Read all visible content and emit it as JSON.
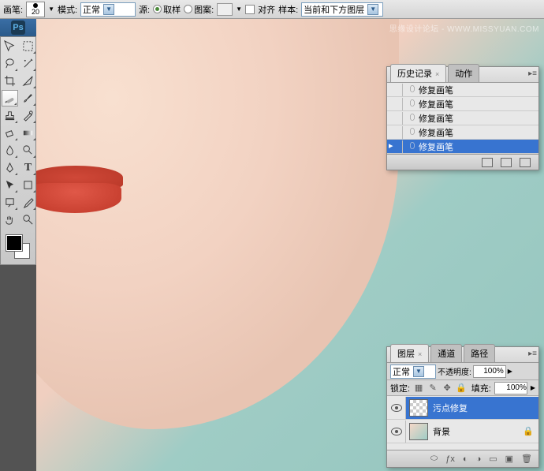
{
  "watermark": "思缘设计论坛 - WWW.MISSYUAN.COM",
  "toolbar": {
    "brush_lbl": "画笔:",
    "brush_size": "20",
    "mode_lbl": "模式:",
    "mode_val": "正常",
    "source_lbl": "源:",
    "sample_lbl": "取样",
    "pattern_lbl": "图案:",
    "align_lbl": "对齐",
    "sample_type_lbl": "样本:",
    "sample_type_val": "当前和下方图层"
  },
  "ps": "Ps",
  "history_panel": {
    "tabs": [
      {
        "label": "历史记录",
        "active": true
      },
      {
        "label": "动作",
        "active": false
      }
    ],
    "items": [
      {
        "label": "修复画笔",
        "sel": false
      },
      {
        "label": "修复画笔",
        "sel": false
      },
      {
        "label": "修复画笔",
        "sel": false
      },
      {
        "label": "修复画笔",
        "sel": false
      },
      {
        "label": "修复画笔",
        "sel": true
      }
    ]
  },
  "layers_panel": {
    "tabs": [
      {
        "label": "图层",
        "active": true
      },
      {
        "label": "通道",
        "active": false
      },
      {
        "label": "路径",
        "active": false
      }
    ],
    "blend_mode": "正常",
    "opacity_lbl": "不透明度:",
    "opacity_val": "100%",
    "lock_lbl": "锁定:",
    "fill_lbl": "填充:",
    "fill_val": "100%",
    "layers": [
      {
        "name": "污点修复",
        "sel": true,
        "thumb": "checker",
        "locked": false
      },
      {
        "name": "背景",
        "sel": false,
        "thumb": "bg",
        "locked": true
      }
    ]
  }
}
